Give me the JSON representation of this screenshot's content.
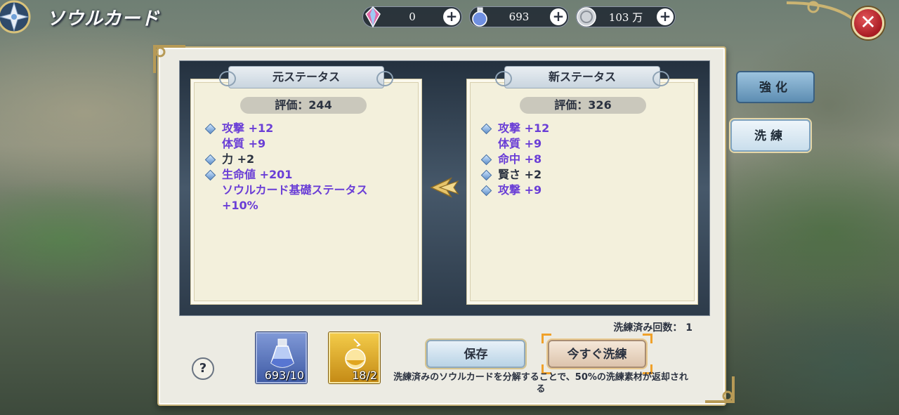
{
  "header": {
    "title": "ソウルカード",
    "currencies": [
      {
        "name": "crystal-icon",
        "value": "0"
      },
      {
        "name": "potion-icon",
        "value": "693"
      },
      {
        "name": "silver-coin-icon",
        "value": "103 万"
      }
    ],
    "plus_label": "+",
    "close_label": "✕"
  },
  "left_card": {
    "title": "元ステータス",
    "evaluation": "評価：244",
    "stats": [
      {
        "text": "攻撃 +12",
        "diamond": true,
        "style": "purple"
      },
      {
        "text": "体質 +9",
        "diamond": false,
        "style": "purple"
      },
      {
        "text": "力 +2",
        "diamond": true,
        "style": "plain"
      },
      {
        "text": "生命値 +201",
        "diamond": true,
        "style": "purple"
      },
      {
        "text": "ソウルカード基礎ステータス",
        "diamond": false,
        "style": "purple"
      },
      {
        "text": "+10%",
        "diamond": false,
        "style": "purple"
      }
    ]
  },
  "right_card": {
    "title": "新ステータス",
    "evaluation": "評価：326",
    "stats": [
      {
        "text": "攻撃 +12",
        "diamond": true,
        "style": "purple"
      },
      {
        "text": "体質 +9",
        "diamond": false,
        "style": "purple"
      },
      {
        "text": "命中 +8",
        "diamond": true,
        "style": "purple"
      },
      {
        "text": "賢さ +2",
        "diamond": true,
        "style": "plain"
      },
      {
        "text": "攻撃 +9",
        "diamond": true,
        "style": "purple"
      }
    ]
  },
  "side_tabs": {
    "enhance": "強化",
    "refine": "洗練"
  },
  "footer": {
    "refine_count": "洗練済み回数： 1",
    "help_label": "?",
    "items": [
      {
        "name": "blue-potion-icon",
        "count": "693/10"
      },
      {
        "name": "gold-potion-icon",
        "count": "18/2"
      }
    ],
    "save_label": "保存",
    "refine_now_label": "今すぐ洗練",
    "notice": "洗練済みのソウルカードを分解することで、50%の洗練素材が返却される"
  },
  "colors": {
    "stat_purple": "#6a3ed6",
    "highlight_frame": "#f0a12a",
    "close_red": "#c0282e"
  }
}
